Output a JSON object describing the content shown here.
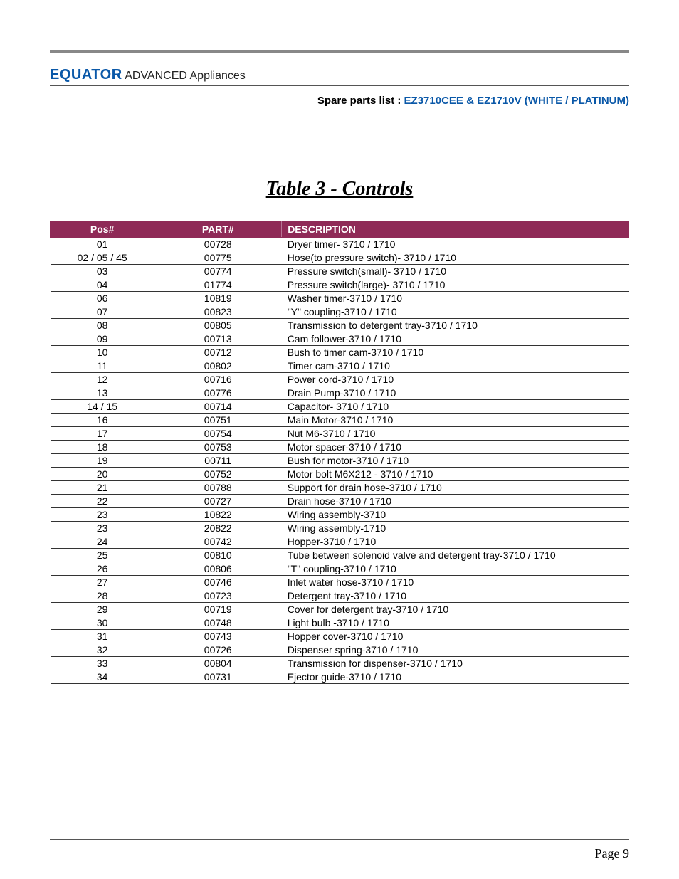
{
  "brand": {
    "name": "EQUATOR",
    "suffix": " ADVANCED Appliances"
  },
  "spare": {
    "label": "Spare parts list : ",
    "models": "EZ3710CEE & EZ1710V (WHITE / PLATINUM)"
  },
  "table_title": "Table 3 - Controls",
  "headers": {
    "pos": "Pos#",
    "part": "PART#",
    "desc": "DESCRIPTION"
  },
  "chart_data": {
    "type": "table",
    "title": "Table 3 - Controls",
    "columns": [
      "Pos#",
      "PART#",
      "DESCRIPTION"
    ],
    "rows": [
      {
        "pos": "01",
        "part": "00728",
        "desc": "Dryer timer- 3710 / 1710"
      },
      {
        "pos": "02 / 05 / 45",
        "part": "00775",
        "desc": "Hose(to pressure switch)- 3710 / 1710"
      },
      {
        "pos": "03",
        "part": "00774",
        "desc": "Pressure switch(small)- 3710 / 1710"
      },
      {
        "pos": "04",
        "part": "01774",
        "desc": "Pressure switch(large)- 3710 / 1710"
      },
      {
        "pos": "06",
        "part": "10819",
        "desc": "Washer timer-3710 / 1710"
      },
      {
        "pos": "07",
        "part": "00823",
        "desc": "\"Y\" coupling-3710 / 1710"
      },
      {
        "pos": "08",
        "part": "00805",
        "desc": "Transmission to detergent tray-3710 / 1710"
      },
      {
        "pos": "09",
        "part": "00713",
        "desc": "Cam follower-3710 / 1710"
      },
      {
        "pos": "10",
        "part": "00712",
        "desc": "Bush to timer cam-3710 / 1710"
      },
      {
        "pos": "11",
        "part": "00802",
        "desc": "Timer cam-3710 / 1710"
      },
      {
        "pos": "12",
        "part": "00716",
        "desc": "Power cord-3710 / 1710"
      },
      {
        "pos": "13",
        "part": "00776",
        "desc": "Drain Pump-3710 / 1710"
      },
      {
        "pos": "14 / 15",
        "part": "00714",
        "desc": "Capacitor- 3710 / 1710"
      },
      {
        "pos": "16",
        "part": "00751",
        "desc": "Main Motor-3710 / 1710"
      },
      {
        "pos": "17",
        "part": "00754",
        "desc": "Nut M6-3710 / 1710"
      },
      {
        "pos": "18",
        "part": "00753",
        "desc": "Motor spacer-3710 / 1710"
      },
      {
        "pos": "19",
        "part": "00711",
        "desc": "Bush for motor-3710 / 1710"
      },
      {
        "pos": "20",
        "part": "00752",
        "desc": "Motor bolt M6X212 - 3710 / 1710"
      },
      {
        "pos": "21",
        "part": "00788",
        "desc": "Support for drain hose-3710 / 1710"
      },
      {
        "pos": "22",
        "part": "00727",
        "desc": "Drain hose-3710 / 1710"
      },
      {
        "pos": "23",
        "part": "10822",
        "desc": "Wiring assembly-3710"
      },
      {
        "pos": "23",
        "part": "20822",
        "desc": "Wiring assembly-1710"
      },
      {
        "pos": "24",
        "part": "00742",
        "desc": "Hopper-3710 / 1710"
      },
      {
        "pos": "25",
        "part": "00810",
        "desc": "Tube between solenoid valve and detergent tray-3710 / 1710"
      },
      {
        "pos": "26",
        "part": "00806",
        "desc": "\"T\" coupling-3710 / 1710"
      },
      {
        "pos": "27",
        "part": "00746",
        "desc": "Inlet water hose-3710 / 1710"
      },
      {
        "pos": "28",
        "part": "00723",
        "desc": "Detergent tray-3710 / 1710"
      },
      {
        "pos": "29",
        "part": "00719",
        "desc": "Cover for detergent tray-3710 / 1710"
      },
      {
        "pos": "30",
        "part": "00748",
        "desc": "Light bulb -3710 / 1710"
      },
      {
        "pos": "31",
        "part": "00743",
        "desc": "Hopper cover-3710 / 1710"
      },
      {
        "pos": "32",
        "part": "00726",
        "desc": "Dispenser spring-3710 / 1710"
      },
      {
        "pos": "33",
        "part": "00804",
        "desc": "Transmission for dispenser-3710 / 1710"
      },
      {
        "pos": "34",
        "part": "00731",
        "desc": "Ejector guide-3710 / 1710"
      }
    ]
  },
  "page_label": "Page 9"
}
